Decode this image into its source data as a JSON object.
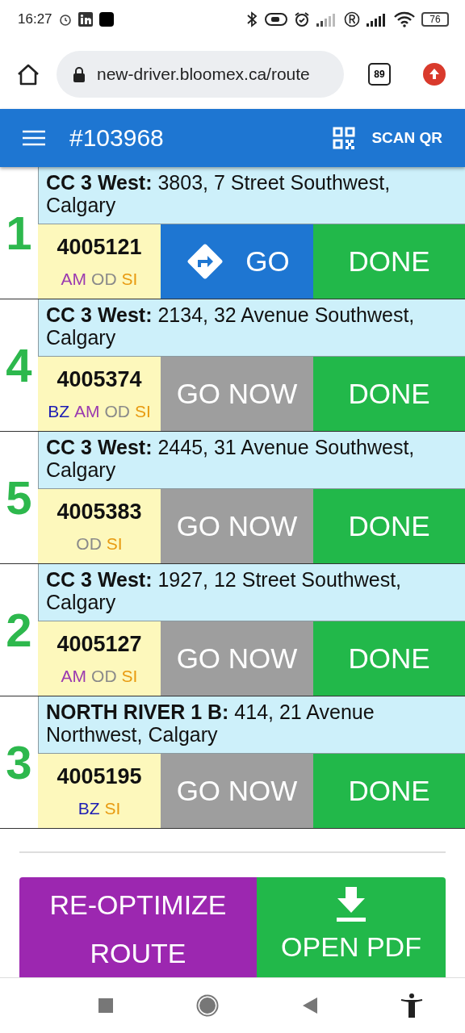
{
  "status_bar": {
    "time": "16:27",
    "battery": "76"
  },
  "browser": {
    "url": "new-driver.bloomex.ca/route",
    "tab_count": "89"
  },
  "app_bar": {
    "title": "#103968",
    "scan_button": "SCAN QR"
  },
  "stops": [
    {
      "number": "1",
      "address": "**CC 3 West:** 3803, 7 Street Southwest, Calgary",
      "order": "4005121",
      "tags": [
        {
          "code": "AM",
          "color": "#9b3bb0"
        },
        {
          "code": "OD",
          "color": "#8a8a8a"
        },
        {
          "code": "SI",
          "color": "#e89a10"
        }
      ],
      "go_button": {
        "label": "GO",
        "active": true
      },
      "done_button": "DONE"
    },
    {
      "number": "4",
      "address": "**CC 3 West:** 2134, 32 Avenue Southwest, Calgary",
      "order": "4005374",
      "tags": [
        {
          "code": "BZ",
          "color": "#1c1cb4"
        },
        {
          "code": "AM",
          "color": "#9b3bb0"
        },
        {
          "code": "OD",
          "color": "#8a8a8a"
        },
        {
          "code": "SI",
          "color": "#e89a10"
        }
      ],
      "go_button": {
        "label": "GO NOW",
        "active": false
      },
      "done_button": "DONE"
    },
    {
      "number": "5",
      "address": "**CC 3 West:** 2445, 31 Avenue Southwest, Calgary",
      "order": "4005383",
      "tags": [
        {
          "code": "OD",
          "color": "#8a8a8a"
        },
        {
          "code": "SI",
          "color": "#e89a10"
        }
      ],
      "go_button": {
        "label": "GO NOW",
        "active": false
      },
      "done_button": "DONE"
    },
    {
      "number": "2",
      "address": "**CC 3 West:** 1927, 12 Street Southwest, Calgary",
      "order": "4005127",
      "tags": [
        {
          "code": "AM",
          "color": "#9b3bb0"
        },
        {
          "code": "OD",
          "color": "#8a8a8a"
        },
        {
          "code": "SI",
          "color": "#e89a10"
        }
      ],
      "go_button": {
        "label": "GO NOW",
        "active": false
      },
      "done_button": "DONE"
    },
    {
      "number": "3",
      "address": "**NORTH RIVER 1 B:** 414, 21 Avenue Northwest, Calgary",
      "order": "4005195",
      "tags": [
        {
          "code": "BZ",
          "color": "#1c1cb4"
        },
        {
          "code": "SI",
          "color": "#e89a10"
        }
      ],
      "go_button": {
        "label": "GO NOW",
        "active": false
      },
      "done_button": "DONE"
    }
  ],
  "footer": {
    "reoptimize_button": "RE-OPTIMIZE ROUTE",
    "pdf_button": "OPEN PDF"
  }
}
